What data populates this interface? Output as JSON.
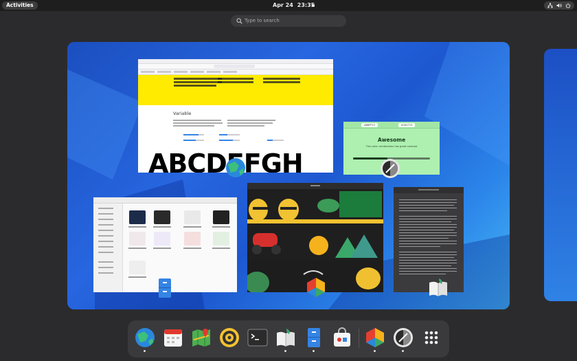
{
  "topbar": {
    "activities_label": "Activities",
    "date": "Apr 24",
    "time": "23:35",
    "tray_icons": [
      "network-icon",
      "volume-icon",
      "power-icon"
    ]
  },
  "search": {
    "placeholder": "Type to search",
    "icon": "search-icon"
  },
  "windows": {
    "browser": {
      "section_heading": "Variable",
      "sample_text": "ABCDEFGH"
    },
    "contrast": {
      "title": "Awesome",
      "subtitle": "This color combination has great contrast",
      "fg_color": "#88FF13",
      "bg_color": "#161713"
    },
    "files": {},
    "art": {},
    "book": {}
  },
  "dock": {
    "items": [
      {
        "name": "web-browser",
        "icon": "globe-icon",
        "running": true
      },
      {
        "name": "calendar",
        "icon": "calendar-icon",
        "running": false
      },
      {
        "name": "maps",
        "icon": "map-icon",
        "running": false
      },
      {
        "name": "music",
        "icon": "speaker-icon",
        "running": false
      },
      {
        "name": "terminal",
        "icon": "terminal-icon",
        "running": false
      },
      {
        "name": "book-reader",
        "icon": "book-icon",
        "running": true
      },
      {
        "name": "files",
        "icon": "cabinet-icon",
        "running": true
      },
      {
        "name": "software",
        "icon": "shopping-bag-icon",
        "running": false
      },
      {
        "name": "art-app",
        "icon": "hexagon-icon",
        "running": true
      },
      {
        "name": "contrast-app",
        "icon": "contrast-icon",
        "running": true
      },
      {
        "name": "show-apps",
        "icon": "grid-icon",
        "running": false
      }
    ]
  },
  "colors": {
    "panel": "#1e1e1e",
    "dock": "#3a3a3c",
    "wallpaper_blue": "#2766e0",
    "accent": "#3584e4"
  }
}
